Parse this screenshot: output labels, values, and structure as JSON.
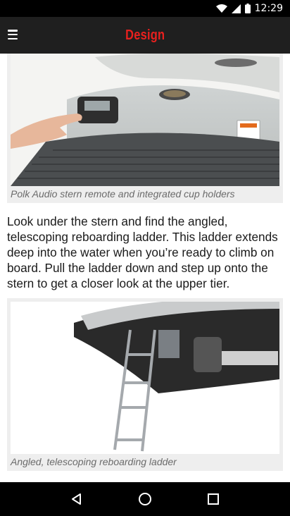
{
  "status_bar": {
    "time": "12:29",
    "icons": [
      "wifi-icon",
      "signal-icon",
      "battery-icon"
    ]
  },
  "app_bar": {
    "title": "Design",
    "title_color": "#e8201e",
    "menu_icon": "hamburger-menu-icon"
  },
  "article": {
    "figure1": {
      "caption": "Polk Audio stern remote and integrated cup holders"
    },
    "paragraph": "Look under the stern and find the angled, telescoping reboarding ladder. This ladder extends deep into the water when you’re ready to climb on board. Pull the ladder down and step up onto the stern to get a closer look at the upper tier.",
    "figure2": {
      "caption": "Angled, telescoping reboarding ladder"
    }
  },
  "nav_bar": {
    "icons": [
      "back-icon",
      "home-icon",
      "recents-icon"
    ]
  }
}
